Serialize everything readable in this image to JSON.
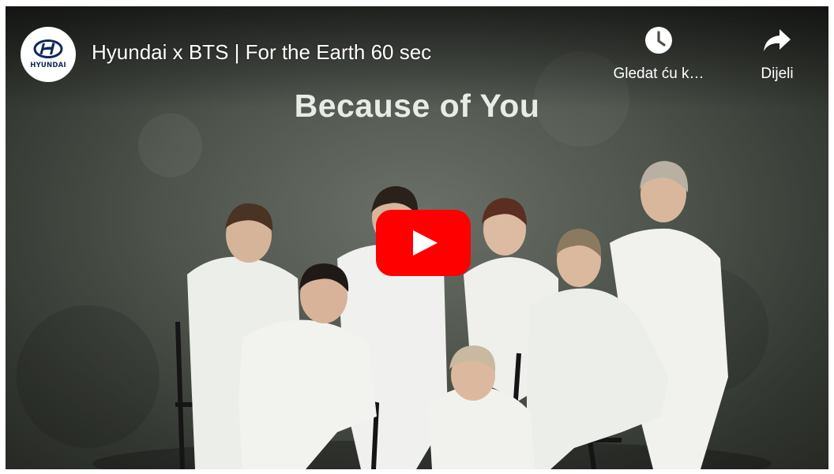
{
  "video": {
    "title": "Hyundai x BTS | For the Earth 60 sec",
    "overlay_text": "Because of You"
  },
  "channel": {
    "logo_text": "HYUNDAI",
    "logo_icon": "hyundai-logo-icon"
  },
  "actions": {
    "watch_later": {
      "label": "Gledat ću k…",
      "icon": "clock-icon"
    },
    "share": {
      "label": "Dijeli",
      "icon": "share-arrow-icon"
    }
  },
  "play_button": {
    "icon": "play-icon",
    "color": "#ff0000"
  },
  "colors": {
    "title_text": "#ffffff",
    "logo_blue": "#0c2a5b",
    "background": "#4d524b"
  }
}
